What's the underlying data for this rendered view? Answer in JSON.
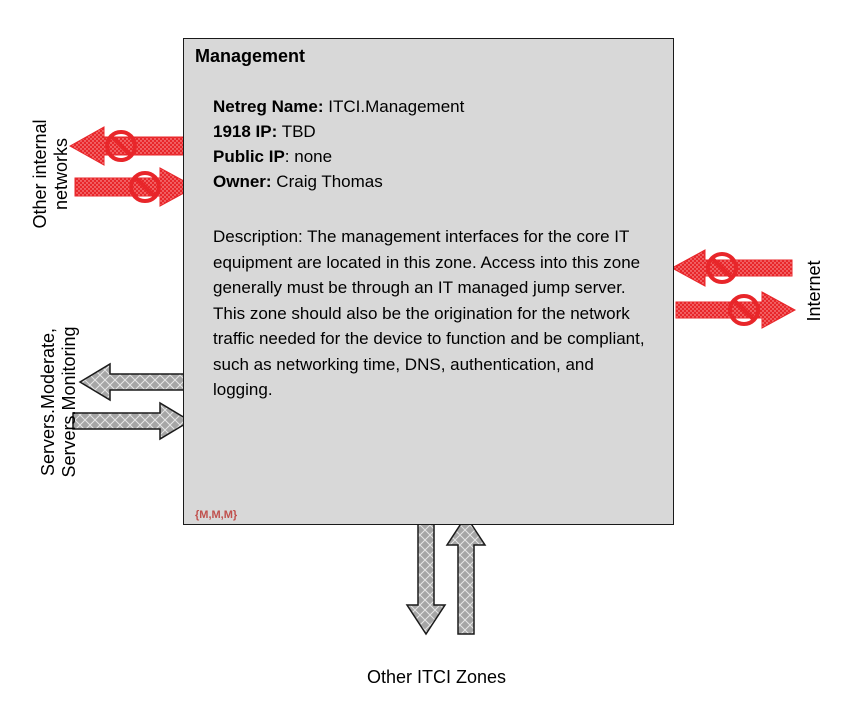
{
  "zone": {
    "title": "Management",
    "netreg_label": "Netreg Name:",
    "netreg_value": "ITCI.Management",
    "ip1918_label": "1918 IP:",
    "ip1918_value": "TBD",
    "public_ip_label": "Public IP",
    "public_ip_value": ": none",
    "owner_label": "Owner:",
    "owner_value": "Craig Thomas",
    "description": "Description: The management interfaces for the core IT equipment are located in this zone. Access into this zone generally must be through an IT managed jump server.  This zone should also be the origination for the network traffic needed for the device to function and be compliant, such as networking time, DNS, authentication, and logging.",
    "rating": "{M,M,M}"
  },
  "labels": {
    "other_internal_1": "Other internal",
    "other_internal_2": "networks",
    "servers_1": "Servers.Moderate,",
    "servers_2": "Servers.Monitoring",
    "internet": "Internet",
    "other_itci_zones": "Other ITCI Zones"
  },
  "colors": {
    "blocked_arrow": "#e8262a",
    "allowed_arrow": "#a6a6a6",
    "zone_fill": "#d8d8d8",
    "rating_text": "#c0504d"
  }
}
